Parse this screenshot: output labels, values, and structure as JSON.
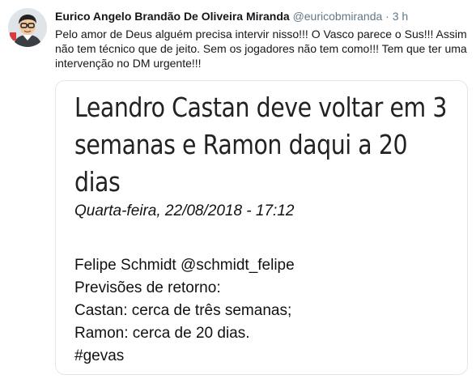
{
  "tweet": {
    "author_name": "Eurico Angelo Brandão De Oliveira Miranda",
    "handle": "@euricobmiranda",
    "separator": "·",
    "time": "3 h",
    "text": "Pelo amor de Deus alguém precisa intervir nisso!!! O Vasco parece o Sus!!! Assim não tem técnico que de jeito. Sem os jogadores não tem como!!! Tem que ter uma intervenção no DM urgente!!!"
  },
  "card": {
    "headline": "Leandro Castan deve voltar em 3 semanas e Ramon daqui a 20 dias",
    "date": "Quarta-feira, 22/08/2018 - 17:12",
    "body_lines": [
      "Felipe Schmidt @schmidt_felipe",
      "Previsões de retorno:",
      "Castan: cerca de três semanas;",
      "Ramon: cerca de 20 dias.",
      "#gevas"
    ]
  }
}
